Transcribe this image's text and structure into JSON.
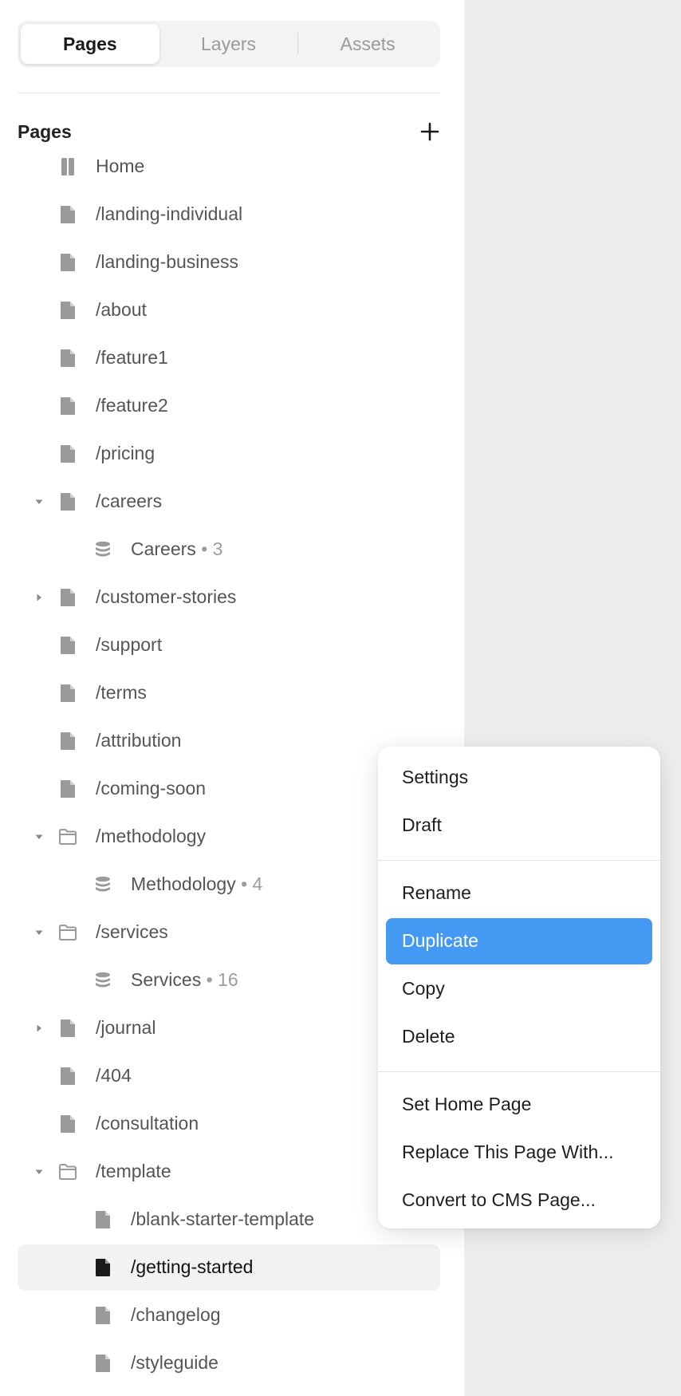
{
  "tabs": [
    {
      "label": "Pages",
      "active": true
    },
    {
      "label": "Layers",
      "active": false
    },
    {
      "label": "Assets",
      "active": false
    }
  ],
  "section": {
    "title": "Pages",
    "add_icon": "plus-icon"
  },
  "pages": [
    {
      "label": "Home",
      "icon": "home-icon",
      "depth": 0,
      "caret": "none",
      "partial": true
    },
    {
      "label": "/landing-individual",
      "icon": "page-icon",
      "depth": 0,
      "caret": "none"
    },
    {
      "label": "/landing-business",
      "icon": "page-icon",
      "depth": 0,
      "caret": "none"
    },
    {
      "label": "/about",
      "icon": "page-icon",
      "depth": 0,
      "caret": "none"
    },
    {
      "label": "/feature1",
      "icon": "page-icon",
      "depth": 0,
      "caret": "none"
    },
    {
      "label": "/feature2",
      "icon": "page-icon",
      "depth": 0,
      "caret": "none"
    },
    {
      "label": "/pricing",
      "icon": "page-icon",
      "depth": 0,
      "caret": "none"
    },
    {
      "label": "/careers",
      "icon": "page-icon",
      "depth": 0,
      "caret": "down"
    },
    {
      "label": "Careers",
      "count": "3",
      "icon": "database-icon",
      "depth": 1,
      "caret": "none"
    },
    {
      "label": "/customer-stories",
      "icon": "page-icon",
      "depth": 0,
      "caret": "right"
    },
    {
      "label": "/support",
      "icon": "page-icon",
      "depth": 0,
      "caret": "none"
    },
    {
      "label": "/terms",
      "icon": "page-icon",
      "depth": 0,
      "caret": "none"
    },
    {
      "label": "/attribution",
      "icon": "page-icon",
      "depth": 0,
      "caret": "none"
    },
    {
      "label": "/coming-soon",
      "icon": "page-icon",
      "depth": 0,
      "caret": "none"
    },
    {
      "label": "/methodology",
      "icon": "folder-icon",
      "depth": 0,
      "caret": "down"
    },
    {
      "label": "Methodology",
      "count": "4",
      "icon": "database-icon",
      "depth": 1,
      "caret": "none"
    },
    {
      "label": "/services",
      "icon": "folder-icon",
      "depth": 0,
      "caret": "down"
    },
    {
      "label": "Services",
      "count": "16",
      "icon": "database-icon",
      "depth": 1,
      "caret": "none"
    },
    {
      "label": "/journal",
      "icon": "page-icon",
      "depth": 0,
      "caret": "right"
    },
    {
      "label": "/404",
      "icon": "page-icon",
      "depth": 0,
      "caret": "none"
    },
    {
      "label": "/consultation",
      "icon": "page-icon",
      "depth": 0,
      "caret": "none"
    },
    {
      "label": "/template",
      "icon": "folder-icon",
      "depth": 0,
      "caret": "down"
    },
    {
      "label": "/blank-starter-template",
      "icon": "page-icon",
      "depth": 1,
      "caret": "none"
    },
    {
      "label": "/getting-started",
      "icon": "page-icon",
      "depth": 1,
      "caret": "none",
      "selected": true
    },
    {
      "label": "/changelog",
      "icon": "page-icon",
      "depth": 1,
      "caret": "none"
    },
    {
      "label": "/styleguide",
      "icon": "page-icon",
      "depth": 1,
      "caret": "none"
    }
  ],
  "context_menu": {
    "groups": [
      [
        {
          "label": "Settings"
        },
        {
          "label": "Draft"
        }
      ],
      [
        {
          "label": "Rename"
        },
        {
          "label": "Duplicate",
          "highlighted": true
        },
        {
          "label": "Copy"
        },
        {
          "label": "Delete"
        }
      ],
      [
        {
          "label": "Set Home Page"
        },
        {
          "label": "Replace This Page With..."
        },
        {
          "label": "Convert to CMS Page..."
        }
      ]
    ]
  },
  "colors": {
    "highlight": "#4499f3",
    "icon_gray": "#9a9a9a",
    "icon_selected": "#1a1a1a",
    "canvas": "#eeeeee"
  }
}
